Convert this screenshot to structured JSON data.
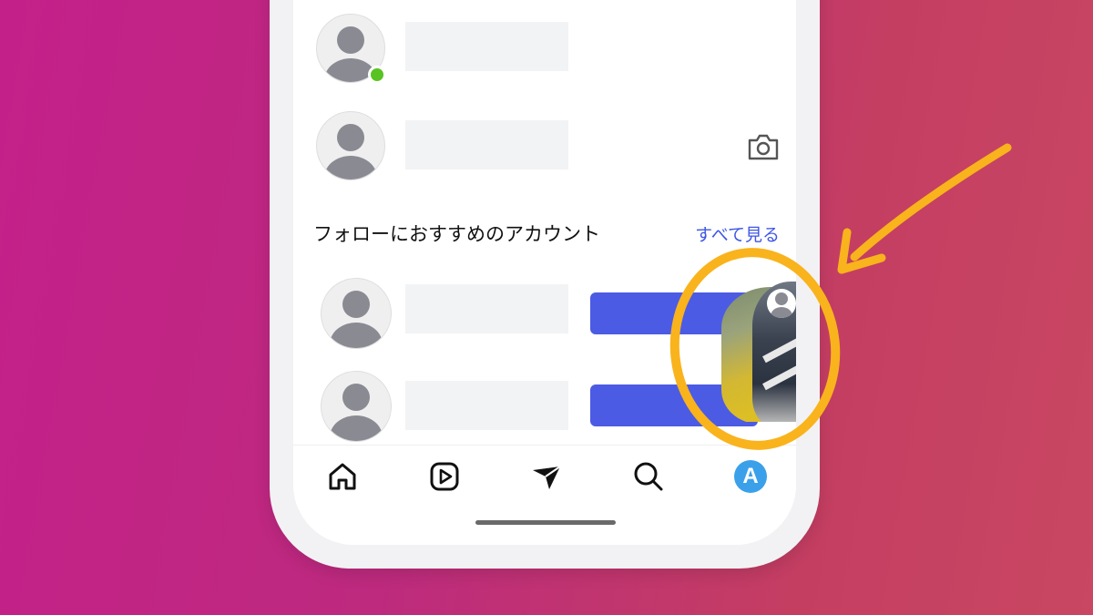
{
  "suggestions": {
    "title": "フォローにおすすめのアカウント",
    "see_all": "すべて見る"
  },
  "icons": {
    "camera": "camera-icon",
    "home": "home-icon",
    "reels": "reels-icon",
    "direct": "direct-send-icon",
    "search": "search-icon",
    "profile": "profile-icon"
  },
  "profile_badge": {
    "letter": "A"
  },
  "colors": {
    "background_left": "#c4208a",
    "background_right": "#c94762",
    "follow_button": "#4c5be4",
    "see_all_link": "#3d56e6",
    "online_dot": "#58c322",
    "annotation": "#f9b31c",
    "profile_badge": "#3aa0ea"
  }
}
